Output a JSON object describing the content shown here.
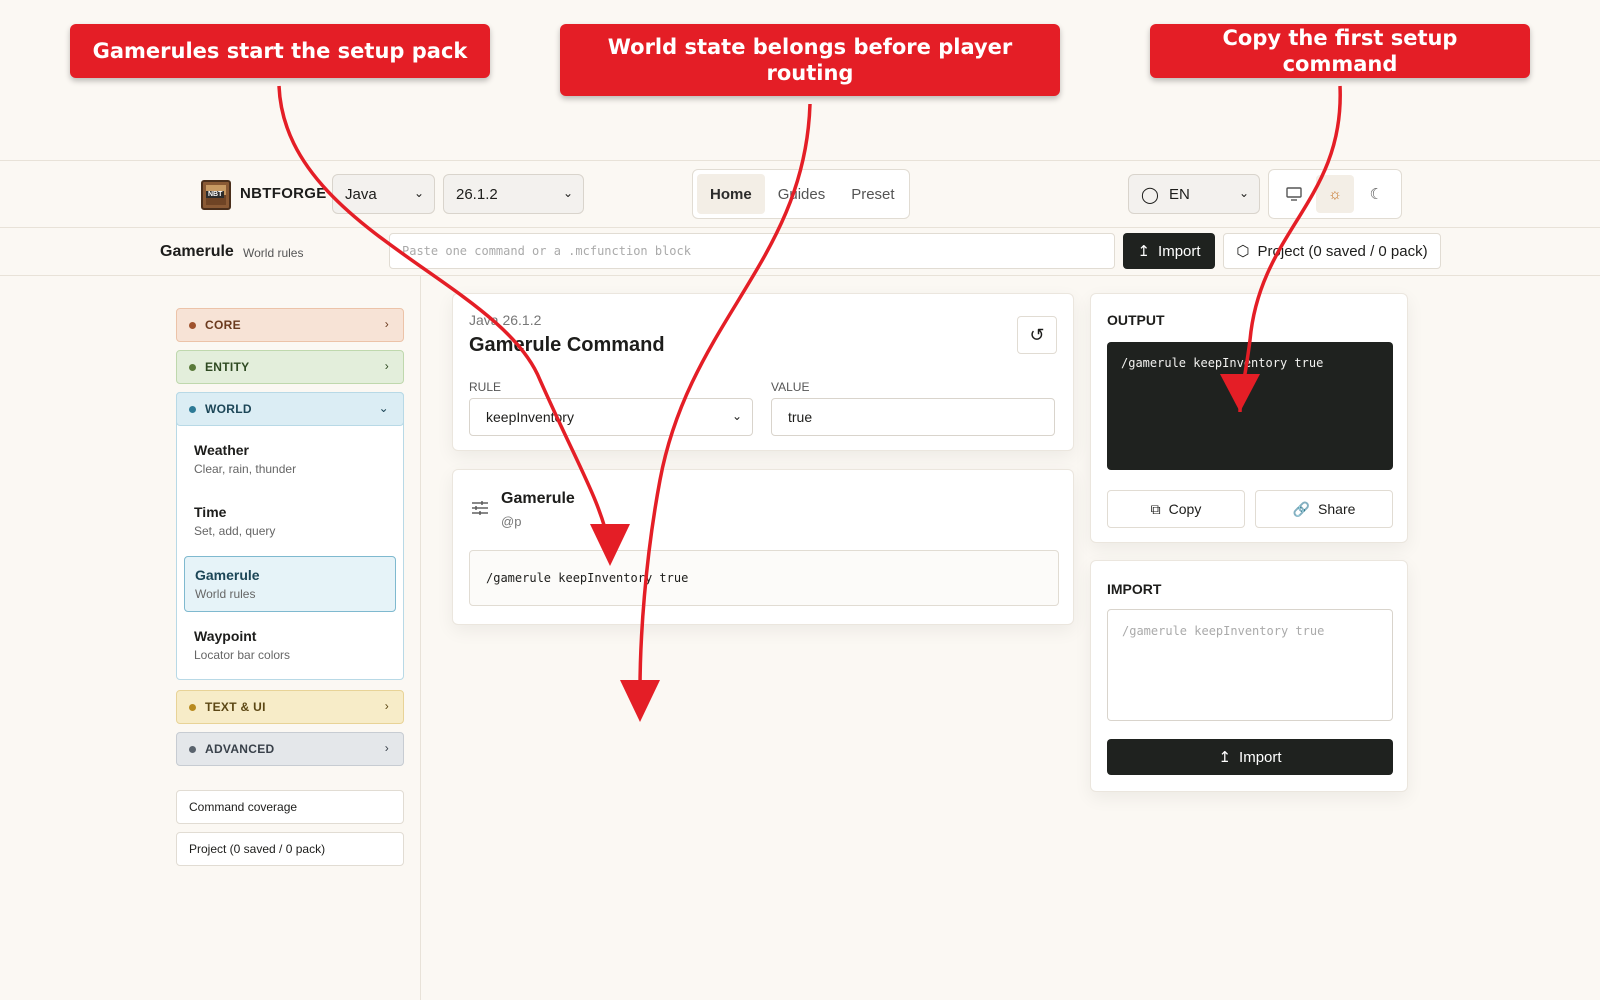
{
  "annotations": {
    "callout1": "Gamerules start the setup pack",
    "callout2": "World state belongs before player routing",
    "callout3": "Copy the first setup command"
  },
  "header": {
    "logo_badge": "NBT",
    "brand": "NBTFORGE",
    "edition": "Java",
    "version": "26.1.2",
    "nav": [
      "Home",
      "Guides",
      "Preset"
    ],
    "language": "EN",
    "theme_icons": [
      "monitor-icon",
      "sun-icon",
      "moon-icon"
    ]
  },
  "subbar": {
    "title": "Gamerule",
    "subtitle": "World rules",
    "import_placeholder": "Paste one command or a .mcfunction block",
    "import_label": "Import",
    "project_label": "Project (0 saved / 0 pack)"
  },
  "sidebar": {
    "categories": {
      "core": "CORE",
      "entity": "ENTITY",
      "world": "WORLD",
      "text": "TEXT & UI",
      "advanced": "ADVANCED"
    },
    "world_items": [
      {
        "title": "Weather",
        "desc": "Clear, rain, thunder"
      },
      {
        "title": "Time",
        "desc": "Set, add, query"
      },
      {
        "title": "Gamerule",
        "desc": "World rules"
      },
      {
        "title": "Waypoint",
        "desc": "Locator bar colors"
      }
    ],
    "links": [
      "Command coverage",
      "Project (0 saved / 0 pack)"
    ]
  },
  "command_panel": {
    "breadcrumb": "Java 26.1.2",
    "title": "Gamerule Command",
    "rule_label": "RULE",
    "rule_value": "keepInventory",
    "value_label": "VALUE",
    "value_value": "true"
  },
  "preview_panel": {
    "title": "Gamerule",
    "selector": "@p",
    "command": "/gamerule keepInventory true"
  },
  "output_panel": {
    "heading": "OUTPUT",
    "command": "/gamerule keepInventory true",
    "copy_label": "Copy",
    "share_label": "Share"
  },
  "import_panel": {
    "heading": "IMPORT",
    "placeholder": "/gamerule keepInventory true",
    "button_label": "Import"
  },
  "colors": {
    "callout": "#e41e26",
    "dark": "#1f221f",
    "background": "#fbf8f3"
  }
}
